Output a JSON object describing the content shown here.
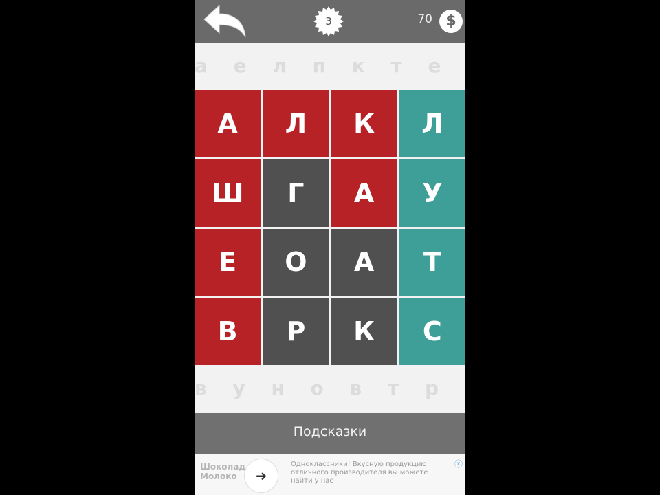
{
  "header": {
    "level": "3",
    "coins": "70",
    "coin_symbol": "$"
  },
  "background_letters": {
    "top": "а е л п к т е т у о а м ш о",
    "bottom": "в у н о в т р о к а о е"
  },
  "grid": {
    "cells": [
      {
        "letter": "А",
        "color": "red"
      },
      {
        "letter": "Л",
        "color": "red"
      },
      {
        "letter": "К",
        "color": "red"
      },
      {
        "letter": "Л",
        "color": "teal"
      },
      {
        "letter": "Ш",
        "color": "red"
      },
      {
        "letter": "Г",
        "color": "dark"
      },
      {
        "letter": "А",
        "color": "red"
      },
      {
        "letter": "У",
        "color": "teal"
      },
      {
        "letter": "Е",
        "color": "red"
      },
      {
        "letter": "О",
        "color": "dark"
      },
      {
        "letter": "А",
        "color": "dark"
      },
      {
        "letter": "Т",
        "color": "teal"
      },
      {
        "letter": "В",
        "color": "red"
      },
      {
        "letter": "Р",
        "color": "dark"
      },
      {
        "letter": "К",
        "color": "dark"
      },
      {
        "letter": "С",
        "color": "teal"
      }
    ]
  },
  "hints_button": {
    "label": "Подсказки"
  },
  "ad": {
    "logo_text": "Шоколад Молоко",
    "arrow": "➜",
    "text": "Одноклассники! Вкусную продукцию отличного производителя вы можете найти у нас",
    "close": "ⓧ"
  },
  "colors": {
    "red": "#b72226",
    "dark": "#505050",
    "teal": "#3e9e98",
    "topbar": "#6a6a6a"
  }
}
